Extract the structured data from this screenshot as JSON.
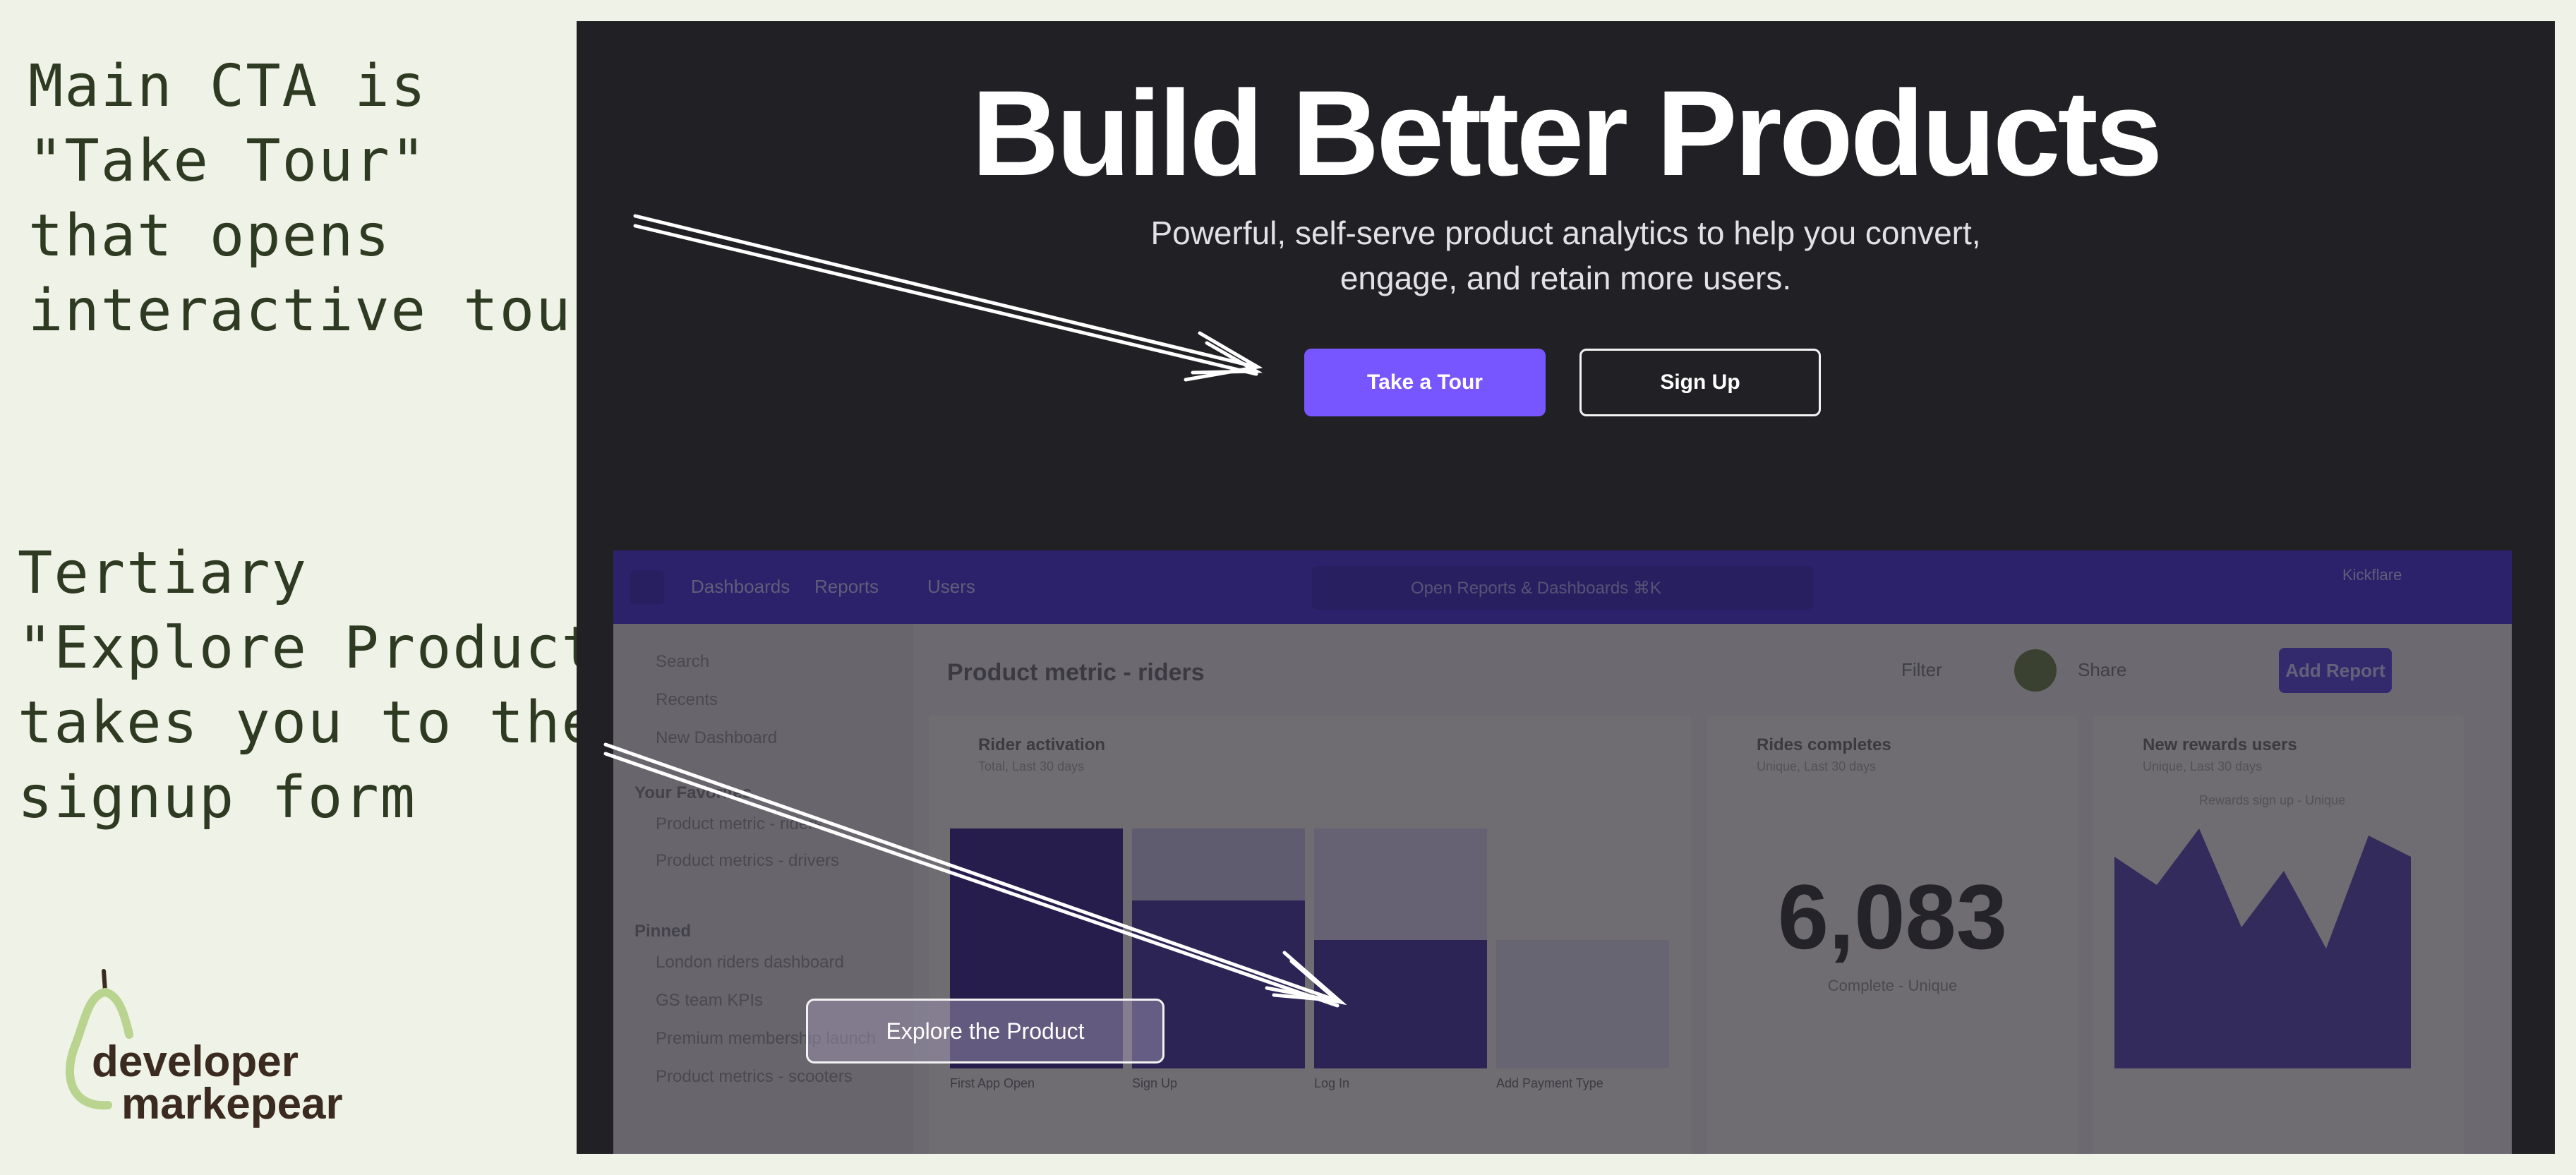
{
  "notes": {
    "note1": "Main CTA is\n\"Take Tour\"\nthat opens\ninteractive tour",
    "note2": "Tertiary\n\"Explore Product\"\ntakes you to the\nsignup form"
  },
  "logo": {
    "line1": "developer",
    "line2": "markepear"
  },
  "hero": {
    "headline": "Build Better Products",
    "subtitle_line1": "Powerful, self-serve product analytics to help you convert,",
    "subtitle_line2": "engage, and retain more users.",
    "primary_button": "Take a Tour",
    "secondary_button": "Sign Up",
    "explore_button": "Explore the Product"
  },
  "app": {
    "nav": [
      "Dashboards",
      "Reports",
      "Users"
    ],
    "search_placeholder": "Open Reports & Dashboards ⌘K",
    "account": "Kickflare",
    "sidebar": {
      "top_items": [
        "Search",
        "Recents",
        "New Dashboard"
      ],
      "favorites_heading": "Your Favorites",
      "favorites": [
        "Product metric - riders",
        "Product metrics - drivers"
      ],
      "pinned_heading": "Pinned",
      "pinned": [
        "London riders dashboard",
        "GS team KPIs",
        "Premium membership launch",
        "Product metrics - scooters"
      ]
    },
    "page_title": "Product metric - riders",
    "actions": {
      "filter": "Filter",
      "share": "Share",
      "add_report": "Add Report"
    },
    "cards": [
      {
        "title": "Rider activation",
        "subtitle": "Total, Last 30 days",
        "bars": [
          "First App Open",
          "Sign Up",
          "Log In",
          "Add Payment Type"
        ]
      },
      {
        "title": "Rides completes",
        "subtitle": "Unique, Last 30 days",
        "value": "6,083",
        "value_label": "Complete - Unique"
      },
      {
        "title": "New rewards users",
        "subtitle": "Unique, Last 30 days",
        "legend": "Rewards sign up - Unique"
      }
    ]
  }
}
